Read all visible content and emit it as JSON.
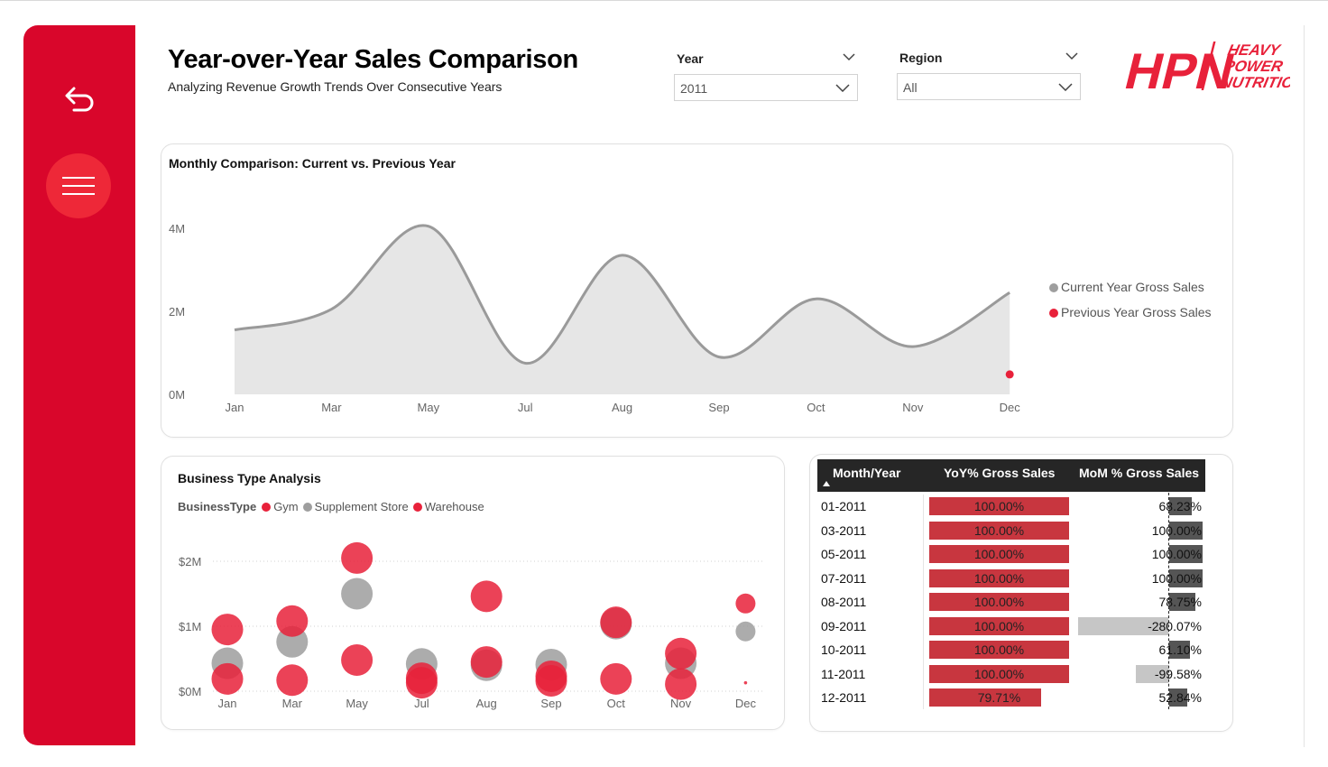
{
  "header": {
    "title": "Year-over-Year Sales Comparison",
    "subtitle": "Analyzing Revenue Growth Trends Over Consecutive Years"
  },
  "sidebar": {
    "back_icon": "back-arrow-icon",
    "menu_icon": "hamburger-menu-icon"
  },
  "filters": {
    "year": {
      "label": "Year",
      "value": "2011"
    },
    "region": {
      "label": "Region",
      "value": "All"
    }
  },
  "logo": {
    "text": "HPN",
    "tagline": [
      "HEAVY",
      "POWER",
      "NUTRITION"
    ]
  },
  "colors": {
    "brand_red": "#d9062b",
    "accent_red": "#e8213a",
    "grey_series": "#9e9e9e",
    "area_fill": "#e6e6e6",
    "table_header": "#262626",
    "yoy_bar": "#c8363f"
  },
  "monthly_chart": {
    "title": "Monthly Comparison: Current vs. Previous Year",
    "legend": [
      "Current Year Gross Sales",
      "Previous Year Gross Sales"
    ]
  },
  "business_chart": {
    "title": "Business Type Analysis",
    "legend_title": "BusinessType",
    "legend": [
      "Gym",
      "Supplement Store",
      "Warehouse"
    ]
  },
  "table": {
    "headers": [
      "Month/Year",
      "YoY% Gross Sales",
      "MoM % Gross Sales"
    ],
    "rows": [
      {
        "month": "01-2011",
        "yoy": "100.00%",
        "mom": "68.23%"
      },
      {
        "month": "03-2011",
        "yoy": "100.00%",
        "mom": "100.00%"
      },
      {
        "month": "05-2011",
        "yoy": "100.00%",
        "mom": "100.00%"
      },
      {
        "month": "07-2011",
        "yoy": "100.00%",
        "mom": "100.00%"
      },
      {
        "month": "08-2011",
        "yoy": "100.00%",
        "mom": "78.75%"
      },
      {
        "month": "09-2011",
        "yoy": "100.00%",
        "mom": "-280.07%"
      },
      {
        "month": "10-2011",
        "yoy": "100.00%",
        "mom": "61.10%"
      },
      {
        "month": "11-2011",
        "yoy": "100.00%",
        "mom": "-99.58%"
      },
      {
        "month": "12-2011",
        "yoy": "79.71%",
        "mom": "52.84%"
      }
    ],
    "yoy_values": [
      100,
      100,
      100,
      100,
      100,
      100,
      100,
      100,
      79.71
    ],
    "mom_values": [
      68.23,
      100,
      100,
      100,
      78.75,
      -280.07,
      61.1,
      -99.58,
      52.84
    ]
  },
  "chart_data": [
    {
      "type": "area",
      "title": "Monthly Comparison: Current vs. Previous Year",
      "categories": [
        "Jan",
        "Mar",
        "May",
        "Jul",
        "Aug",
        "Sep",
        "Oct",
        "Nov",
        "Dec"
      ],
      "yticks": [
        "0M",
        "2M",
        "4M"
      ],
      "ylim": [
        0,
        4000000
      ],
      "series": [
        {
          "name": "Current Year Gross Sales",
          "values": [
            1550000,
            2050000,
            4050000,
            750000,
            3350000,
            900000,
            2300000,
            1150000,
            2450000
          ]
        },
        {
          "name": "Previous Year Gross Sales",
          "values": [
            null,
            null,
            null,
            null,
            null,
            null,
            null,
            null,
            480000
          ]
        }
      ],
      "legend_position": "right"
    },
    {
      "type": "scatter",
      "title": "Business Type Analysis",
      "categories": [
        "Jan",
        "Mar",
        "May",
        "Jul",
        "Aug",
        "Sep",
        "Oct",
        "Nov",
        "Dec"
      ],
      "yticks": [
        "$0M",
        "$1M",
        "$2M"
      ],
      "ylim": [
        0,
        2200000
      ],
      "series": [
        {
          "name": "Gym",
          "values": [
            950000,
            1080000,
            2050000,
            200000,
            1460000,
            230000,
            1060000,
            580000,
            1350000
          ]
        },
        {
          "name": "Supplement Store",
          "values": [
            430000,
            760000,
            1500000,
            420000,
            400000,
            410000,
            1040000,
            430000,
            920000
          ]
        },
        {
          "name": "Warehouse",
          "values": [
            190000,
            170000,
            480000,
            130000,
            450000,
            160000,
            190000,
            110000,
            130000
          ]
        }
      ],
      "legend_position": "top-left"
    }
  ]
}
